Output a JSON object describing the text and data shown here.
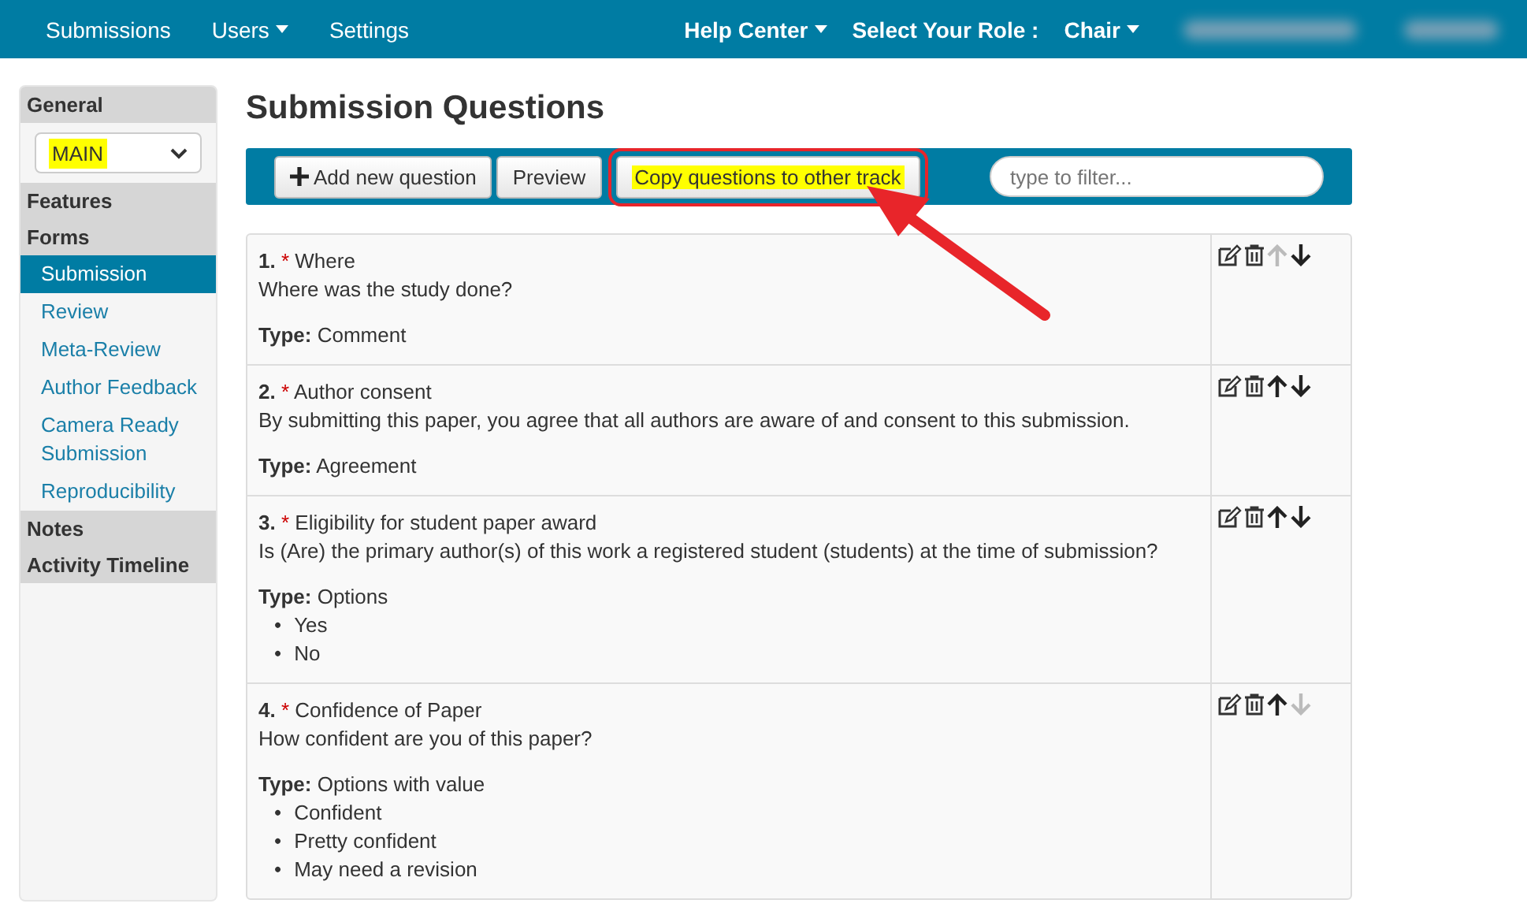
{
  "topbar": {
    "left": [
      {
        "label": "Submissions",
        "dropdown": false
      },
      {
        "label": "Users",
        "dropdown": true
      },
      {
        "label": "Settings",
        "dropdown": false
      }
    ],
    "right": [
      {
        "label": "Help Center",
        "dropdown": true
      },
      {
        "label": "Select Your Role :",
        "dropdown": false
      },
      {
        "label": "Chair",
        "dropdown": true
      }
    ]
  },
  "sidebar": {
    "sections": [
      {
        "label": "General",
        "kind": "select",
        "value": "MAIN",
        "highlighted": true
      },
      {
        "label": "Features",
        "kind": "plain"
      },
      {
        "label": "Forms",
        "kind": "list",
        "items": [
          {
            "label": "Submission",
            "selected": true
          },
          {
            "label": "Review",
            "selected": false
          },
          {
            "label": "Meta-Review",
            "selected": false
          },
          {
            "label": "Author Feedback",
            "selected": false
          },
          {
            "label": "Camera Ready Submission",
            "selected": false
          },
          {
            "label": "Reproducibility",
            "selected": false
          }
        ]
      },
      {
        "label": "Notes",
        "kind": "plain"
      },
      {
        "label": "Activity Timeline",
        "kind": "plain"
      }
    ]
  },
  "title": "Submission Questions",
  "toolbar": {
    "buttons": [
      {
        "label": "Add new question",
        "kind": "add",
        "highlighted": false
      },
      {
        "label": "Preview",
        "kind": "plain",
        "highlighted": false
      },
      {
        "label": "Copy questions to other track",
        "kind": "plain",
        "highlighted": true,
        "callout": true
      }
    ],
    "filter": {
      "placeholder": "type to filter..."
    }
  },
  "questions": [
    {
      "number": "1.",
      "required": "*",
      "title": "Where",
      "description": "Where was the study done?",
      "type_label": "Type:",
      "type": "Comment",
      "up_enabled": false,
      "down_enabled": true
    },
    {
      "number": "2.",
      "required": "*",
      "title": "Author consent",
      "description": "By submitting this paper, you agree that all authors are aware of and consent to this submission.",
      "type_label": "Type:",
      "type": "Agreement",
      "up_enabled": true,
      "down_enabled": true
    },
    {
      "number": "3.",
      "required": "*",
      "title": "Eligibility for student paper award",
      "description": "Is (Are) the primary author(s) of this work a registered student (students) at the time of submission?",
      "type_label": "Type:",
      "type": "Options",
      "options": [
        {
          "bullet": "•",
          "label": "Yes"
        },
        {
          "bullet": "•",
          "label": "No"
        }
      ],
      "up_enabled": true,
      "down_enabled": true
    },
    {
      "number": "4.",
      "required": "*",
      "title": "Confidence of Paper",
      "description": "How confident are you of this paper?",
      "type_label": "Type:",
      "type": "Options with value",
      "options": [
        {
          "bullet": "•",
          "label": "Confident"
        },
        {
          "bullet": "•",
          "label": "Pretty confident"
        },
        {
          "bullet": "•",
          "label": "May need a revision"
        }
      ],
      "up_enabled": true,
      "down_enabled": false
    }
  ]
}
